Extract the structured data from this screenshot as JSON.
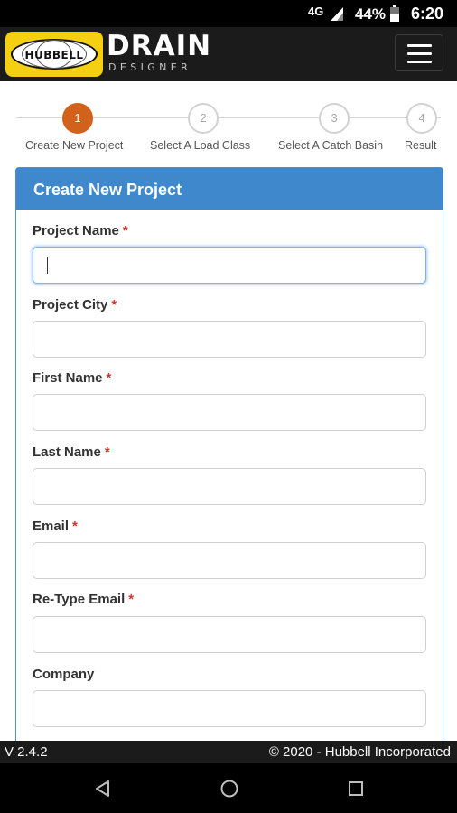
{
  "status_bar": {
    "network": "4G",
    "battery_percent": "44%",
    "time": "6:20",
    "icons": [
      "signal-icon",
      "battery-icon"
    ]
  },
  "header": {
    "logo_text": "HUBBELL",
    "brand_title": "DRAIN",
    "brand_subtitle": "DESIGNER",
    "menu_icon": "hamburger-menu-icon"
  },
  "steps": [
    {
      "number": "1",
      "label": "Create New Project",
      "active": true
    },
    {
      "number": "2",
      "label": "Select A Load Class",
      "active": false
    },
    {
      "number": "3",
      "label": "Select A Catch Basin",
      "active": false
    },
    {
      "number": "4",
      "label": "Result",
      "active": false
    }
  ],
  "form": {
    "title": "Create New Project",
    "required_marker": "*",
    "fields": [
      {
        "label": "Project Name",
        "value": "",
        "required": true
      },
      {
        "label": "Project City",
        "value": "",
        "required": true
      },
      {
        "label": "First Name",
        "value": "",
        "required": true
      },
      {
        "label": "Last Name",
        "value": "",
        "required": true
      },
      {
        "label": "Email",
        "value": "",
        "required": true
      },
      {
        "label": "Re-Type Email",
        "value": "",
        "required": true
      },
      {
        "label": "Company",
        "value": "",
        "required": false
      }
    ]
  },
  "footer": {
    "version": "V 2.4.2",
    "copyright": "© 2020 - Hubbell Incorporated"
  },
  "nav_bar": {
    "icons": [
      "back-icon",
      "home-icon",
      "recents-icon"
    ]
  },
  "colors": {
    "accent_orange": "#d2611c",
    "panel_blue": "#3f88cb",
    "logo_yellow": "#f4cf12",
    "required_red": "#d0342c"
  }
}
